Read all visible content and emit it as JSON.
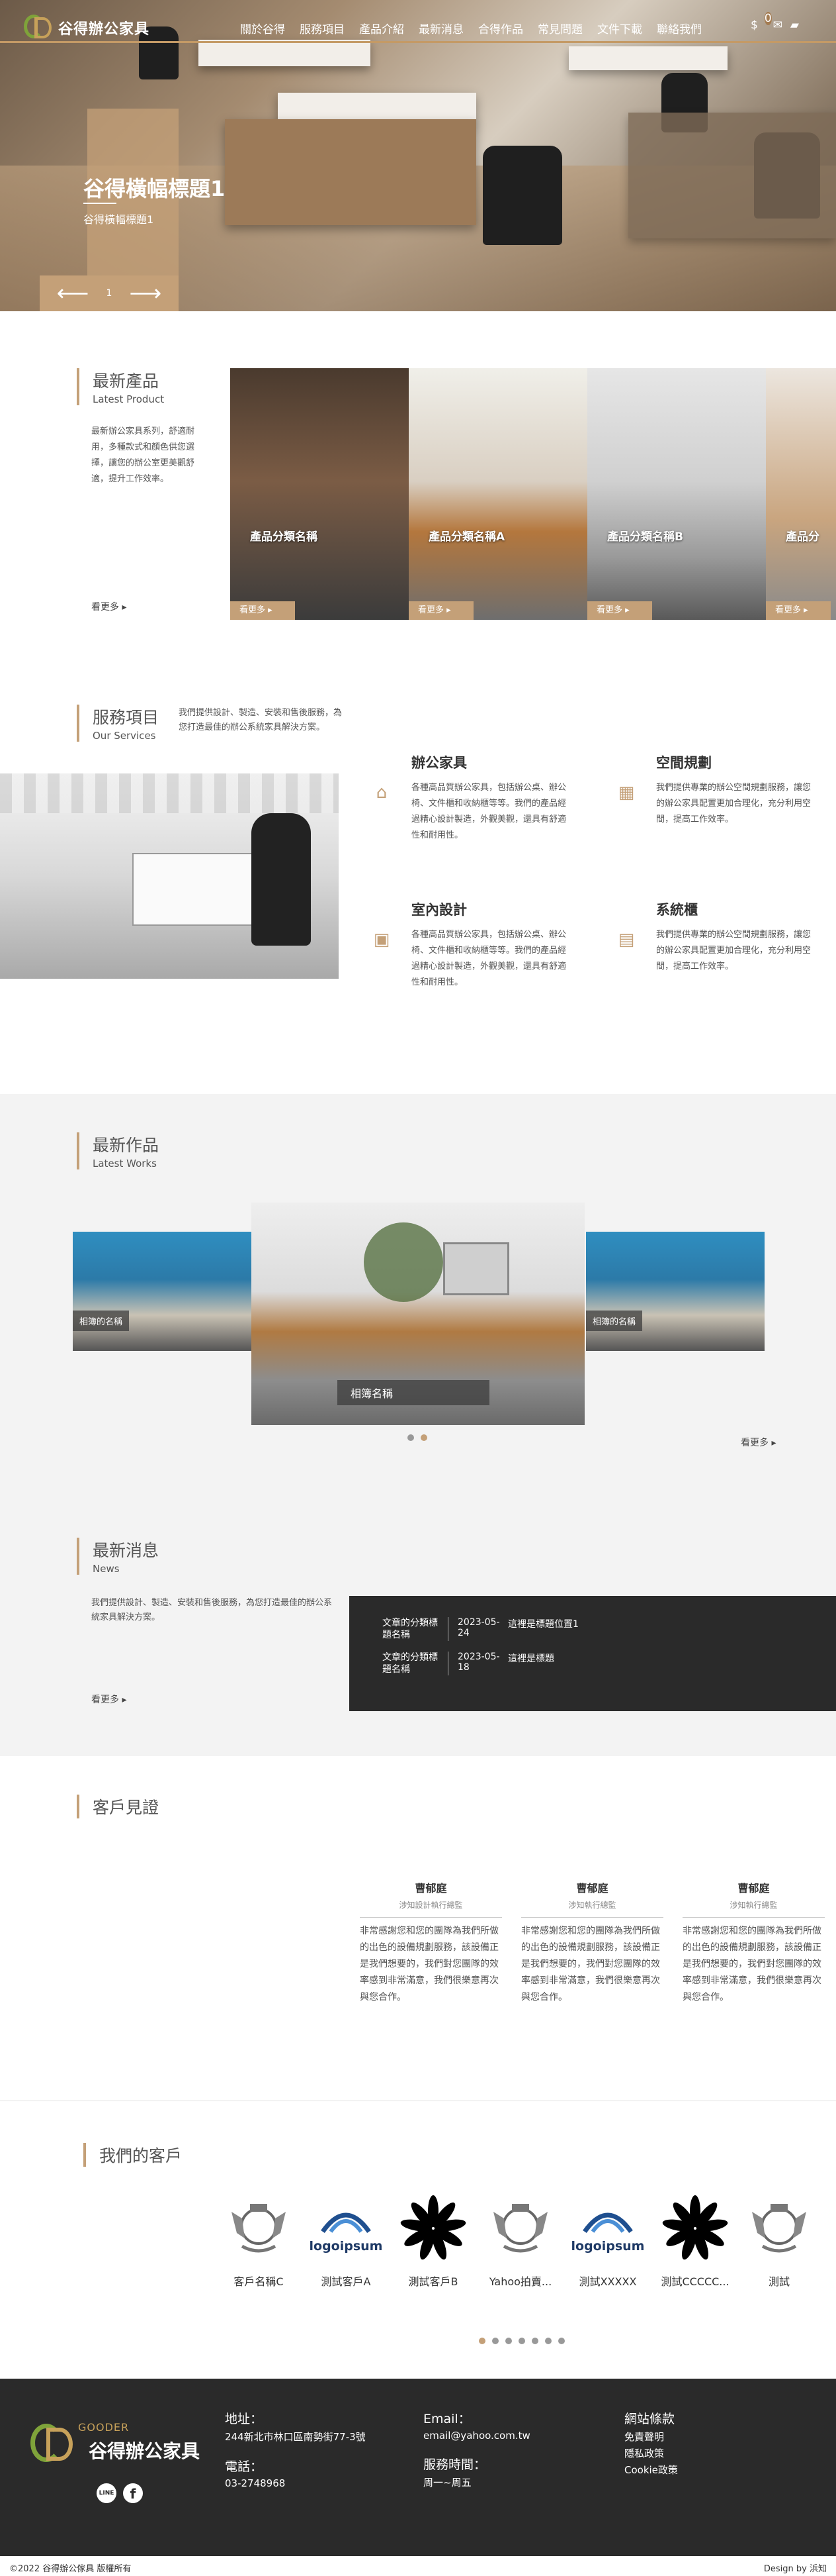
{
  "brand": {
    "name": "谷得辦公家具"
  },
  "nav": [
    "關於谷得",
    "服務項目",
    "產品介紹",
    "最新消息",
    "合得作品",
    "常見問題",
    "文件下載",
    "聯絡我們"
  ],
  "nav_icons": {
    "cart_count": "0"
  },
  "hero": {
    "title": "谷得橫幅標題1",
    "subtitle": "谷得橫幅標題1",
    "page": "1"
  },
  "products": {
    "title_zh": "最新產品",
    "title_en": "Latest Product",
    "desc": "最新辦公家具系列，舒適耐用，多種款式和顏色供您選擇，讓您的辦公室更美觀舒適，提升工作效率。",
    "more": "看更多 ▸",
    "items": [
      {
        "label": "產品分類名稱",
        "btn": "看更多 ▸"
      },
      {
        "label": "產品分類名稱A",
        "btn": "看更多 ▸"
      },
      {
        "label": "產品分類名稱B",
        "btn": "看更多 ▸"
      },
      {
        "label": "產品分",
        "btn": "看更多 ▸"
      }
    ]
  },
  "services": {
    "title_zh": "服務項目",
    "title_en": "Our Services",
    "desc": "我們提供設計、製造、安裝和售後服務，為您打造最佳的辦公系統家具解決方案。",
    "items": [
      {
        "title": "辦公家具",
        "text": "各種高品質辦公家具，包括辦公桌、辦公椅、文件櫃和收納櫃等等。我們的產品經過精心設計製造，外觀美觀，還具有舒適性和耐用性。"
      },
      {
        "title": "空間規劃",
        "text": "我們提供專業的辦公空間規劃服務，讓您的辦公家具配置更加合理化，充分利用空間，提高工作效率。"
      },
      {
        "title": "室內設計",
        "text": "各種高品質辦公家具，包括辦公桌、辦公椅、文件櫃和收納櫃等等。我們的產品經過精心設計製造，外觀美觀，還具有舒適性和耐用性。"
      },
      {
        "title": "系統櫃",
        "text": "我們提供專業的辦公空間規劃服務，讓您的辦公家具配置更加合理化，充分利用空間，提高工作效率。"
      }
    ]
  },
  "works": {
    "title_zh": "最新作品",
    "title_en": "Latest Works",
    "captions": [
      "相簿的名稱",
      "相簿名稱",
      "相簿的名稱"
    ],
    "more": "看更多 ▸"
  },
  "news": {
    "title_zh": "最新消息",
    "title_en": "News",
    "desc": "我們提供設計、製造、安裝和售後服務，為您打造最佳的辦公系統家具解決方案。",
    "more": "看更多 ▸",
    "items": [
      {
        "cat": "文章的分類標題名稱",
        "date": "2023-05-24",
        "title": "這裡是標題位置1"
      },
      {
        "cat": "文章的分類標題名稱",
        "date": "2023-05-18",
        "title": "這裡是標題"
      }
    ]
  },
  "testimonials": {
    "title": "客戶見證",
    "items": [
      {
        "name": "曹郁庭",
        "role": "涉知設計執行總監",
        "text": "非常感謝您和您的團隊為我們所做的出色的設備規劃服務，該設備正是我們想要的，我們對您團隊的效率感到非常滿意，我們很樂意再次與您合作。"
      },
      {
        "name": "曹郁庭",
        "role": "涉知執行總監",
        "text": "非常感謝您和您的團隊為我們所做的出色的設備規劃服務，該設備正是我們想要的，我們對您團隊的效率感到非常滿意，我們很樂意再次與您合作。"
      },
      {
        "name": "曹郁庭",
        "role": "涉知執行總監",
        "text": "非常感謝您和您的團隊為我們所做的出色的設備規劃服務，該設備正是我們想要的，我們對您團隊的效率感到非常滿意，我們很樂意再次與您合作。"
      }
    ]
  },
  "clients": {
    "title": "我們的客戶",
    "items": [
      {
        "name": "客戶名稱C",
        "logo": "crest"
      },
      {
        "name": "測試客戶A",
        "logo": "logoipsum"
      },
      {
        "name": "測試客戶B",
        "logo": "flower"
      },
      {
        "name": "Yahoo拍賣...",
        "logo": "crest"
      },
      {
        "name": "測試XXXXX",
        "logo": "logoipsum"
      },
      {
        "name": "測試CCCCC...",
        "logo": "flower"
      },
      {
        "name": "測試",
        "logo": "crest"
      }
    ],
    "logoipsum_text": "logoipsum"
  },
  "footer": {
    "brand_en": "GOODER",
    "brand_zh": "谷得辦公家具",
    "addr_label": "地址：",
    "addr": "244新北市林口區南勢街77-3號",
    "phone_label": "電話：",
    "phone": "03-2748968",
    "email_label": "Email：",
    "email": "email@yahoo.com.tw",
    "hours_label": "服務時間：",
    "hours": "周一~周五",
    "terms_label": "網站條款",
    "links": [
      "免責聲明",
      "隱私政策",
      "Cookie政策"
    ],
    "social": [
      "LINE",
      "f"
    ],
    "copyright": "©2022 谷得辦公傢具 版權所有",
    "design": "Design by 浜知"
  }
}
